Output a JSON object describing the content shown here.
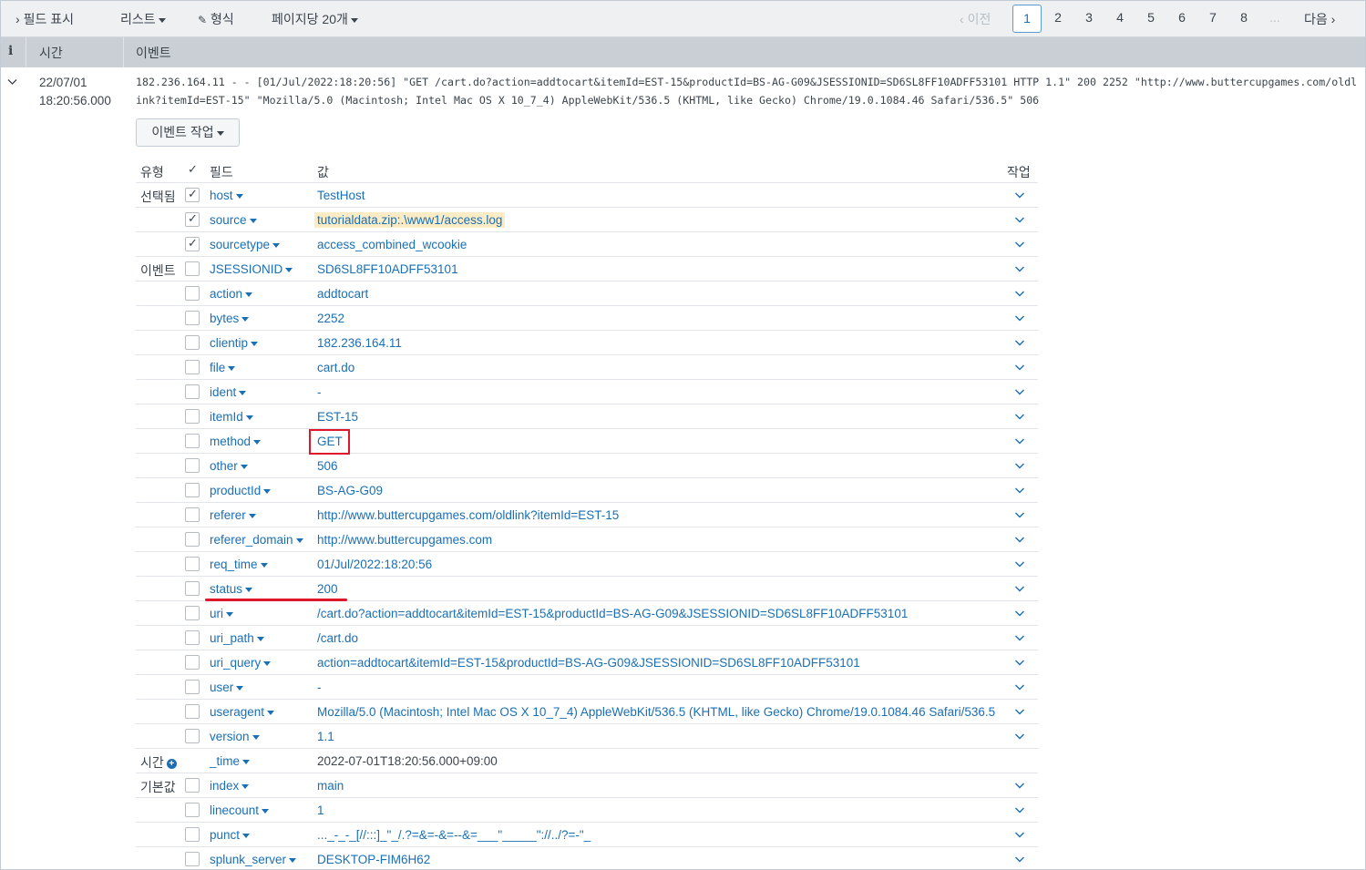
{
  "toolbar": {
    "show_fields": "필드 표시",
    "list": "리스트",
    "format": "형식",
    "per_page": "페이지당 20개",
    "prev": "이전",
    "pages": [
      "1",
      "2",
      "3",
      "4",
      "5",
      "6",
      "7",
      "8",
      "..."
    ],
    "current_page": "1",
    "next": "다음"
  },
  "header": {
    "info": "i",
    "time": "시간",
    "event": "이벤트"
  },
  "event": {
    "date": "22/07/01",
    "time": "18:20:56.000",
    "raw": "182.236.164.11 - - [01/Jul/2022:18:20:56] \"GET /cart.do?action=addtocart&itemId=EST-15&productId=BS-AG-G09&JSESSIONID=SD6SL8FF10ADFF53101 HTTP 1.1\" 200 2252 \"http://www.buttercupgames.com/oldlink?itemId=EST-15\" \"Mozilla/5.0 (Macintosh; Intel Mac OS X 10_7_4) AppleWebKit/536.5 (KHTML, like Gecko) Chrome/19.0.1084.46 Safari/536.5\" 506",
    "actions_button": "이벤트 작업"
  },
  "field_table": {
    "headers": {
      "type": "유형",
      "field": "필드",
      "value": "값",
      "actions": "작업"
    },
    "rows": [
      {
        "type": "선택됨",
        "checked": true,
        "field": "host",
        "value": "TestHost"
      },
      {
        "type": "",
        "checked": true,
        "field": "source",
        "value": "tutorialdata.zip:.\\www1/access.log"
      },
      {
        "type": "",
        "checked": true,
        "field": "sourcetype",
        "value": "access_combined_wcookie"
      },
      {
        "type": "이벤트",
        "checked": false,
        "field": "JSESSIONID",
        "value": "SD6SL8FF10ADFF53101"
      },
      {
        "type": "",
        "checked": false,
        "field": "action",
        "value": "addtocart"
      },
      {
        "type": "",
        "checked": false,
        "field": "bytes",
        "value": "2252"
      },
      {
        "type": "",
        "checked": false,
        "field": "clientip",
        "value": "182.236.164.11"
      },
      {
        "type": "",
        "checked": false,
        "field": "file",
        "value": "cart.do"
      },
      {
        "type": "",
        "checked": false,
        "field": "ident",
        "value": "-"
      },
      {
        "type": "",
        "checked": false,
        "field": "itemId",
        "value": "EST-15"
      },
      {
        "type": "",
        "checked": false,
        "field": "method",
        "value": "GET"
      },
      {
        "type": "",
        "checked": false,
        "field": "other",
        "value": "506"
      },
      {
        "type": "",
        "checked": false,
        "field": "productId",
        "value": "BS-AG-G09"
      },
      {
        "type": "",
        "checked": false,
        "field": "referer",
        "value": "http://www.buttercupgames.com/oldlink?itemId=EST-15"
      },
      {
        "type": "",
        "checked": false,
        "field": "referer_domain",
        "value": "http://www.buttercupgames.com"
      },
      {
        "type": "",
        "checked": false,
        "field": "req_time",
        "value": "01/Jul/2022:18:20:56"
      },
      {
        "type": "",
        "checked": false,
        "field": "status",
        "value": "200"
      },
      {
        "type": "",
        "checked": false,
        "field": "uri",
        "value": "/cart.do?action=addtocart&itemId=EST-15&productId=BS-AG-G09&JSESSIONID=SD6SL8FF10ADFF53101"
      },
      {
        "type": "",
        "checked": false,
        "field": "uri_path",
        "value": "/cart.do"
      },
      {
        "type": "",
        "checked": false,
        "field": "uri_query",
        "value": "action=addtocart&itemId=EST-15&productId=BS-AG-G09&JSESSIONID=SD6SL8FF10ADFF53101"
      },
      {
        "type": "",
        "checked": false,
        "field": "user",
        "value": "-"
      },
      {
        "type": "",
        "checked": false,
        "field": "useragent",
        "value": "Mozilla/5.0 (Macintosh; Intel Mac OS X 10_7_4) AppleWebKit/536.5 (KHTML, like Gecko) Chrome/19.0.1084.46 Safari/536.5"
      },
      {
        "type": "",
        "checked": false,
        "field": "version",
        "value": "1.1"
      },
      {
        "type": "시간",
        "checked": null,
        "field": "_time",
        "value": "2022-07-01T18:20:56.000+09:00"
      },
      {
        "type": "기본값",
        "checked": false,
        "field": "index",
        "value": "main"
      },
      {
        "type": "",
        "checked": false,
        "field": "linecount",
        "value": "1"
      },
      {
        "type": "",
        "checked": false,
        "field": "punct",
        "value": "..._-_-_[//:::]_\"_/.?=&=-&=--&=___\"_____\"://../?=-\"_"
      },
      {
        "type": "",
        "checked": false,
        "field": "splunk_server",
        "value": "DESKTOP-FIM6H62"
      }
    ]
  },
  "colors": {
    "link": "#1a6fb5",
    "highlight": "#e0162b",
    "header_bg": "#c9cfd5"
  }
}
